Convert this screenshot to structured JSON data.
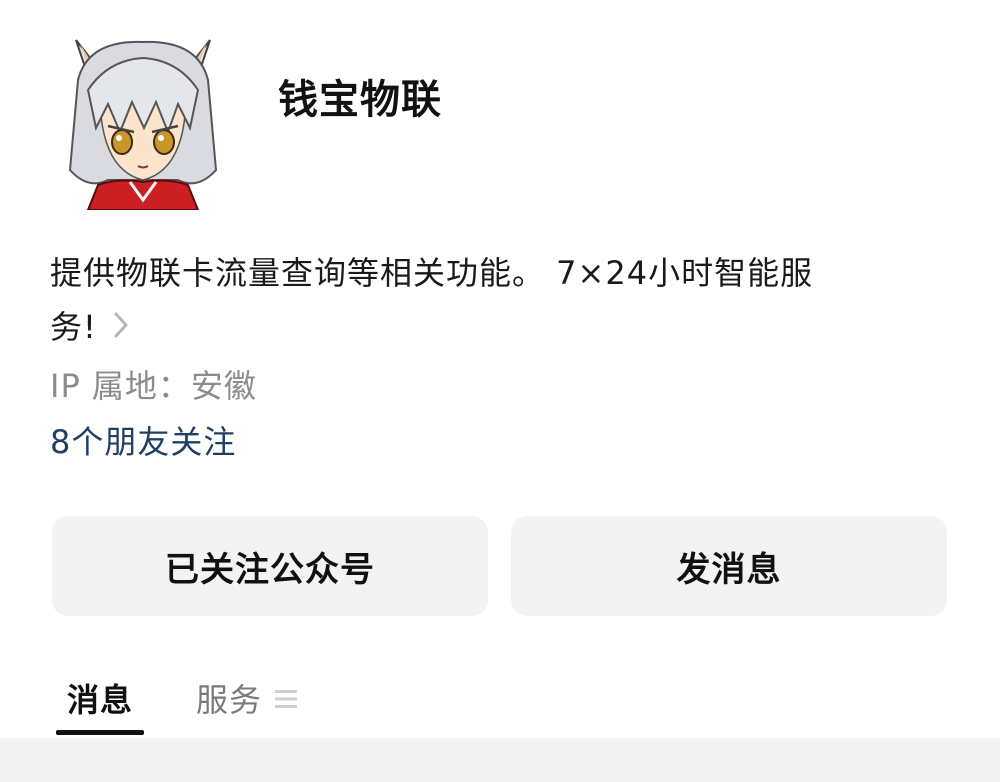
{
  "profile": {
    "name": "钱宝物联",
    "description_line1": "提供物联卡流量查询等相关功能。 7×24小时智能服",
    "description_line2": "务!",
    "ip_location": "IP 属地：安徽",
    "friends_following": "8个朋友关注"
  },
  "actions": {
    "follow_label": "已关注公众号",
    "message_label": "发消息"
  },
  "tabs": [
    {
      "label": "消息",
      "active": true
    },
    {
      "label": "服务",
      "active": false
    }
  ],
  "icons": {
    "avatar": "avatar-illustration",
    "description_more": "chevron-right-icon",
    "services_menu": "menu-icon"
  },
  "colors": {
    "text_primary": "#111111",
    "text_secondary": "#8c8c8c",
    "link": "#1f3f66",
    "button_bg": "#f3f3f3",
    "hair": "#d9dbe0",
    "robe": "#cc1f24"
  }
}
